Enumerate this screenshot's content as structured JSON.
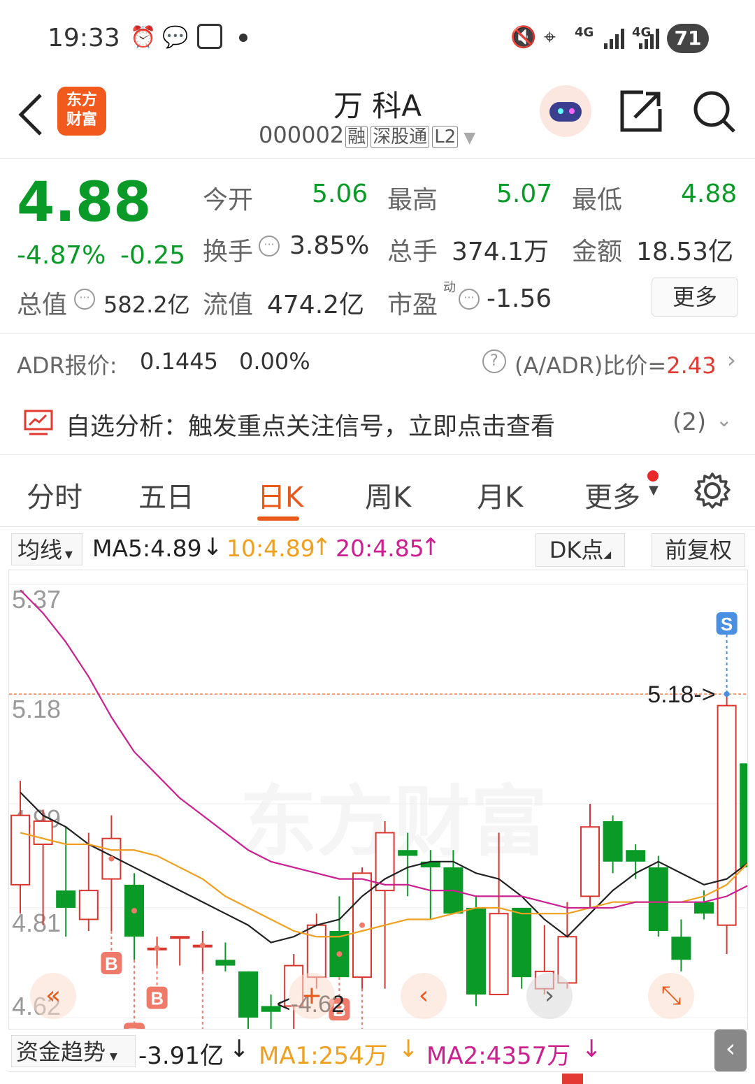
{
  "status_bar": {
    "time": "19:33",
    "network_1": "4G",
    "network_2": "4G",
    "battery": "71"
  },
  "header": {
    "logo_line1": "东方",
    "logo_line2": "财富",
    "stock_name": "万 科A",
    "stock_code": "000002",
    "badge_margin": "融",
    "badge_connect": "深股通",
    "badge_level": "L2"
  },
  "quote": {
    "price": "4.88",
    "change_pct": "-4.87%",
    "change_abs": "-0.25",
    "open_label": "今开",
    "open_value": "5.06",
    "high_label": "最高",
    "high_value": "5.07",
    "low_label": "最低",
    "low_value": "4.88",
    "turnover_label": "换手",
    "turnover_value": "3.85%",
    "volume_label": "总手",
    "volume_value": "374.1万",
    "amount_label": "金额",
    "amount_value": "18.53亿",
    "mktcap_label": "总值",
    "mktcap_value": "582.2亿",
    "float_label": "流值",
    "float_value": "474.2亿",
    "pe_label": "市盈",
    "pe_sup": "动",
    "pe_value": "-1.56",
    "more_button": "更多"
  },
  "adr": {
    "label": "ADR报价:",
    "price": "0.1445",
    "change": "0.00%",
    "ratio_label": "(A/ADR)比价=",
    "ratio_value": "2.43"
  },
  "signal": {
    "text": "自选分析：触发重点关注信号，立即点击查看",
    "count": "(2)"
  },
  "tabs": [
    "分时",
    "五日",
    "日K",
    "周K",
    "月K",
    "更多"
  ],
  "active_tab": "日K",
  "ma_bar": {
    "selector": "均线",
    "ma5": "MA5:4.89",
    "ma10": "10:4.89",
    "ma20": "20:4.85",
    "dk_button": "DK点",
    "adjust_button": "前复权"
  },
  "chart_data": {
    "type": "candlestick",
    "y_ticks": [
      "5.37",
      "5.18",
      "4.99",
      "4.81",
      "4.62"
    ],
    "ylim": [
      4.62,
      5.37
    ],
    "candles": [
      {
        "o": 4.85,
        "h": 5.03,
        "l": 4.8,
        "c": 4.97
      },
      {
        "o": 4.92,
        "h": 4.98,
        "l": 4.78,
        "c": 4.96
      },
      {
        "o": 4.84,
        "h": 4.95,
        "l": 4.76,
        "c": 4.81
      },
      {
        "o": 4.79,
        "h": 4.94,
        "l": 4.77,
        "c": 4.84
      },
      {
        "o": 4.86,
        "h": 4.97,
        "l": 4.77,
        "c": 4.93
      },
      {
        "o": 4.85,
        "h": 4.87,
        "l": 4.72,
        "c": 4.76
      },
      {
        "o": 4.74,
        "h": 4.76,
        "l": 4.71,
        "c": 4.74
      },
      {
        "o": 4.76,
        "h": 4.76,
        "l": 4.71,
        "c": 4.76
      },
      {
        "o": 4.745,
        "h": 4.77,
        "l": 4.7,
        "c": 4.745
      },
      {
        "o": 4.72,
        "h": 4.75,
        "l": 4.7,
        "c": 4.71
      },
      {
        "o": 4.7,
        "h": 4.7,
        "l": 4.59,
        "c": 4.62
      },
      {
        "o": 4.64,
        "h": 4.66,
        "l": 4.58,
        "c": 4.63
      },
      {
        "o": 4.64,
        "h": 4.73,
        "l": 4.6,
        "c": 4.71
      },
      {
        "o": 4.69,
        "h": 4.8,
        "l": 4.67,
        "c": 4.78
      },
      {
        "o": 4.77,
        "h": 4.83,
        "l": 4.69,
        "c": 4.69
      },
      {
        "o": 4.69,
        "h": 4.88,
        "l": 4.67,
        "c": 4.87
      },
      {
        "o": 4.84,
        "h": 4.96,
        "l": 4.67,
        "c": 4.94
      },
      {
        "o": 4.91,
        "h": 4.94,
        "l": 4.83,
        "c": 4.9
      },
      {
        "o": 4.89,
        "h": 4.91,
        "l": 4.79,
        "c": 4.88
      },
      {
        "o": 4.88,
        "h": 4.91,
        "l": 4.85,
        "c": 4.8
      },
      {
        "o": 4.81,
        "h": 4.83,
        "l": 4.64,
        "c": 4.66
      },
      {
        "o": 4.66,
        "h": 4.94,
        "l": 4.66,
        "c": 4.8
      },
      {
        "o": 4.81,
        "h": 4.81,
        "l": 4.67,
        "c": 4.69
      },
      {
        "o": 4.67,
        "h": 4.78,
        "l": 4.66,
        "c": 4.7
      },
      {
        "o": 4.68,
        "h": 4.82,
        "l": 4.67,
        "c": 4.76
      },
      {
        "o": 4.83,
        "h": 4.99,
        "l": 4.81,
        "c": 4.95
      },
      {
        "o": 4.96,
        "h": 4.97,
        "l": 4.87,
        "c": 4.89
      },
      {
        "o": 4.91,
        "h": 4.92,
        "l": 4.86,
        "c": 4.89
      },
      {
        "o": 4.88,
        "h": 4.9,
        "l": 4.76,
        "c": 4.77
      },
      {
        "o": 4.76,
        "h": 4.79,
        "l": 4.7,
        "c": 4.72
      },
      {
        "o": 4.82,
        "h": 4.84,
        "l": 4.79,
        "c": 4.8
      },
      {
        "o": 4.78,
        "h": 5.18,
        "l": 4.73,
        "c": 5.16
      },
      {
        "o": 5.06,
        "h": 5.07,
        "l": 4.88,
        "c": 4.88
      }
    ],
    "series": [
      {
        "name": "MA5",
        "color": "#222222",
        "values": [
          5.01,
          4.97,
          4.95,
          4.92,
          4.9,
          4.88,
          4.86,
          4.84,
          4.82,
          4.8,
          4.78,
          4.75,
          4.76,
          4.78,
          4.79,
          4.83,
          4.86,
          4.88,
          4.89,
          4.89,
          4.87,
          4.86,
          4.83,
          4.79,
          4.76,
          4.8,
          4.84,
          4.87,
          4.89,
          4.87,
          4.85,
          4.86,
          4.89
        ]
      },
      {
        "name": "10",
        "color": "#f0a020",
        "values": [
          4.94,
          4.93,
          4.92,
          4.92,
          4.91,
          4.91,
          4.9,
          4.88,
          4.86,
          4.83,
          4.81,
          4.79,
          4.77,
          4.76,
          4.76,
          4.77,
          4.78,
          4.79,
          4.79,
          4.8,
          4.81,
          4.81,
          4.8,
          4.8,
          4.8,
          4.81,
          4.82,
          4.82,
          4.82,
          4.82,
          4.83,
          4.85,
          4.89
        ]
      },
      {
        "name": "20",
        "color": "#cc2090",
        "values": [
          5.36,
          5.32,
          5.27,
          5.21,
          5.14,
          5.08,
          5.04,
          5.0,
          4.97,
          4.94,
          4.91,
          4.89,
          4.88,
          4.87,
          4.86,
          4.86,
          4.85,
          4.85,
          4.84,
          4.84,
          4.83,
          4.83,
          4.83,
          4.82,
          4.81,
          4.81,
          4.81,
          4.82,
          4.82,
          4.82,
          4.82,
          4.83,
          4.85
        ]
      }
    ],
    "signals": [
      {
        "type": "B",
        "index": 4
      },
      {
        "type": "B",
        "index": 5
      },
      {
        "type": "B",
        "index": 6
      },
      {
        "type": "B",
        "index": 8
      },
      {
        "type": "B",
        "index": 14
      },
      {
        "type": "B",
        "index": 15
      },
      {
        "type": "S",
        "index": 31
      }
    ],
    "high_marker": "5.18->",
    "low_marker": "<-4.62",
    "watermark": "东方财富"
  },
  "fund_bar": {
    "selector": "资金趋势",
    "value": "-3.91亿",
    "ma1": "MA1:254万",
    "ma2": "MA2:4357万"
  }
}
